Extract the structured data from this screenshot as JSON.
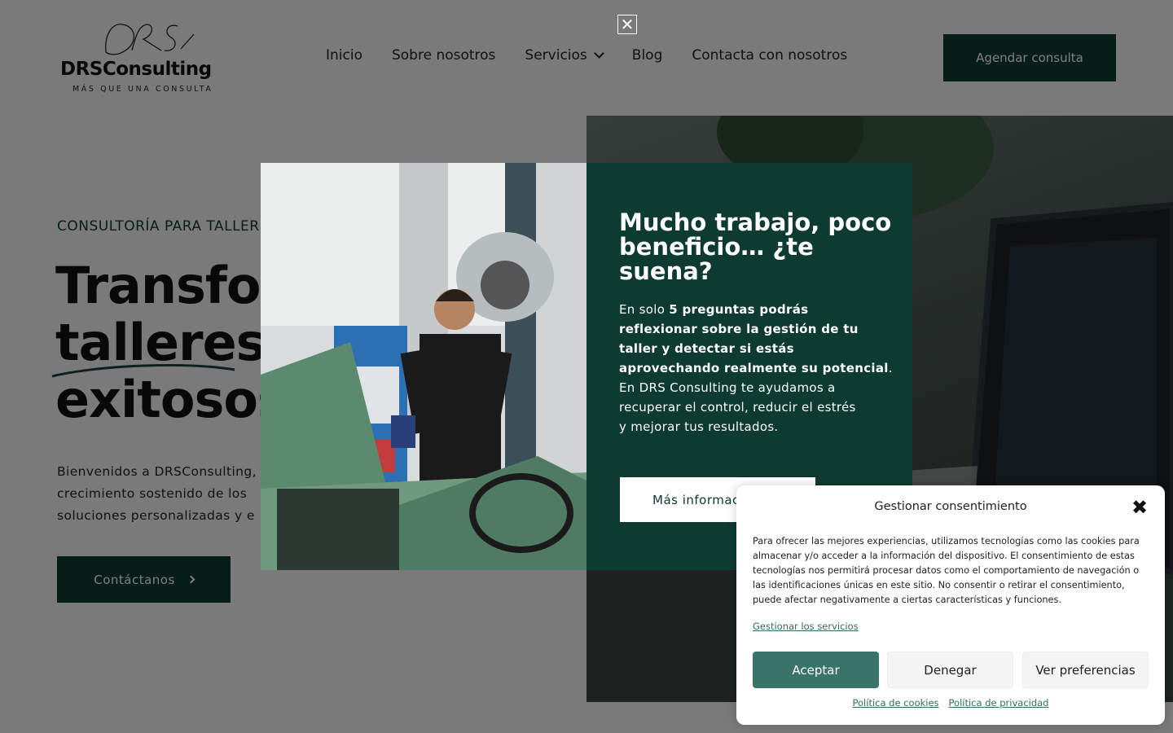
{
  "header": {
    "logo_script": "DRS",
    "logo_name": "DRSConsulting",
    "logo_tagline": "MÁS QUE UNA CONSULTA",
    "nav": [
      "Inicio",
      "Sobre nosotros",
      "Servicios",
      "Blog",
      "Contacta con nosotros"
    ],
    "cta_label": "Agendar consulta"
  },
  "hero": {
    "kicker": "CONSULTORÍA PARA TALLER",
    "title_lines": [
      "Transforr",
      "talleres e",
      "exitosos"
    ],
    "text_lines": [
      "Bienvenidos a DRSConsulting,",
      "crecimiento sostenido de los",
      "soluciones personalizadas y e"
    ],
    "button_label": "Contáctanos"
  },
  "modal": {
    "title_lines": [
      "Mucho trabajo, poco",
      "beneficio… ¿te",
      "suena?"
    ],
    "text": {
      "l1_pre": "En solo ",
      "l1_bold": "5 preguntas podrás",
      "l2": "reflexionar sobre la gestión de tu",
      "l3": "taller y detectar si estás",
      "l4_bold": "aprovechando realmente su potencial",
      "l4_post": ".",
      "l5": "En DRS Consulting te ayudamos a",
      "l6": "recuperar el control, reducir el estrés",
      "l7": "y mejorar tus resultados."
    },
    "button_label": "Más informac",
    "close_glyph": "✕"
  },
  "cookie": {
    "title": "Gestionar consentimiento",
    "close_glyph": "✖",
    "text_lines": [
      "Para ofrecer las mejores experiencias, utilizamos tecnologías como las cookies para",
      "almacenar y/o acceder a la información del dispositivo. El consentimiento de estas",
      "tecnologías nos permitirá procesar datos como el comportamiento de navegación o",
      "las identificaciones únicas en este sitio. No consentir o retirar el consentimiento,",
      "puede afectar negativamente a ciertas características y funciones."
    ],
    "manage_link": "Gestionar los servicios",
    "accept": "Aceptar",
    "deny": "Denegar",
    "preferences": "Ver preferencias",
    "cookie_policy": "Política de cookies",
    "privacy_policy": "Política de privacidad"
  },
  "colors": {
    "brand_dark_green": "#0d3b31",
    "accept_green": "#3a7469",
    "link_green": "#2f6f62"
  }
}
